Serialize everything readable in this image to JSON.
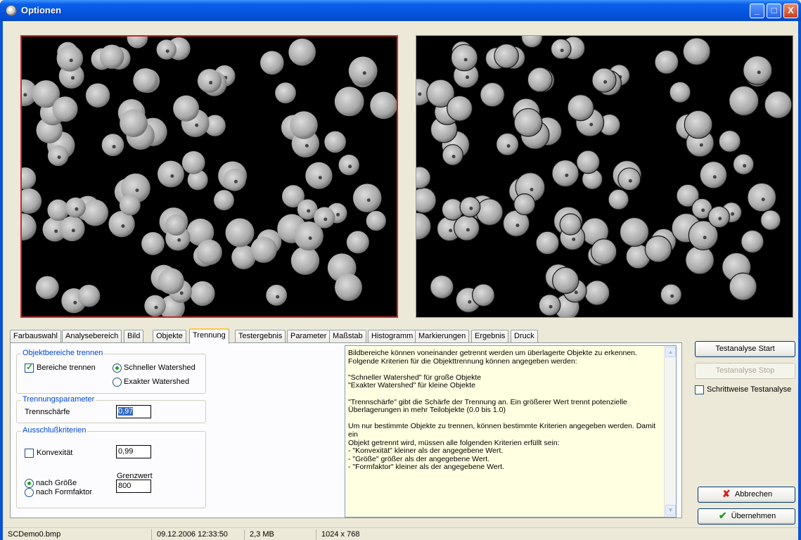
{
  "window": {
    "title": "Optionen",
    "controls": {
      "minimize": "_",
      "maximize": "□",
      "close": "X"
    }
  },
  "tabs": [
    "Farbauswahl",
    "Analysebereich",
    "Bild",
    "Objekte",
    "Trennung",
    "Testergebnis",
    "Parameter",
    "Maßstab",
    "Histogramm",
    "Markierungen",
    "Ergebnis",
    "Druck"
  ],
  "active_tab": "Trennung",
  "separation": {
    "group_title": "Objektbereiche trennen",
    "enable_label": "Bereiche trennen",
    "fast_label": "Schneller Watershed",
    "exact_label": "Exakter Watershed"
  },
  "parameters": {
    "group_title": "Trennungsparameter",
    "sharpness_label": "Trennschärfe",
    "sharpness_value": "0,97"
  },
  "exclusion": {
    "group_title": "Ausschlußkriterien",
    "convexity_label": "Konvexität",
    "convexity_value": "0,99",
    "limit_label": "Grenzwert",
    "limit_value": "800",
    "by_size_label": "nach Größe",
    "by_formfactor_label": "nach Formfaktor"
  },
  "info": [
    "Bildbereiche können voneinander getrennt werden um überlagerte Objekte zu erkennen.",
    "Folgende Kriterien für die Objekttrennung können angegeben werden:",
    "",
    "\"Schneller Watershed\" für große Objekte",
    "\"Exakter Watershed\" für kleine Objekte",
    "",
    "\"Trennschärfe\" gibt die Schärfe der Trennung an. Ein größerer Wert trennt potenzielle",
    "Überlagerungen in mehr Teilobjekte (0.0 bis 1.0)",
    "",
    "Um nur bestimmte Objekte zu trennen, können bestimmte Kriterien angegeben werden. Damit ein",
    "Objekt getrennt wird, müssen alle folgenden Kriterien erfüllt sein:",
    "- \"Konvexität\" kleiner als der angegebene Wert.",
    "- \"Größe\" größer als der angegebene Wert.",
    "- \"Formfaktor\" kleiner als der angegebene Wert."
  ],
  "buttons": {
    "test_start": "Testanalyse Start",
    "test_stop": "Testanalyse Stop",
    "stepwise": "Schrittweise Testanalyse",
    "cancel": "Abbrechen",
    "apply": "Übernehmen"
  },
  "status": {
    "filename": "SCDemo0.bmp",
    "datetime": "09.12.2006 12:33:50",
    "filesize": "2,3 MB",
    "resolution": "1024 x 768"
  },
  "colors": {
    "title_bar": "#0554e0",
    "selection_border": "#c8282c",
    "info_background": "#ffffe1",
    "group_label": "#0046d5"
  }
}
